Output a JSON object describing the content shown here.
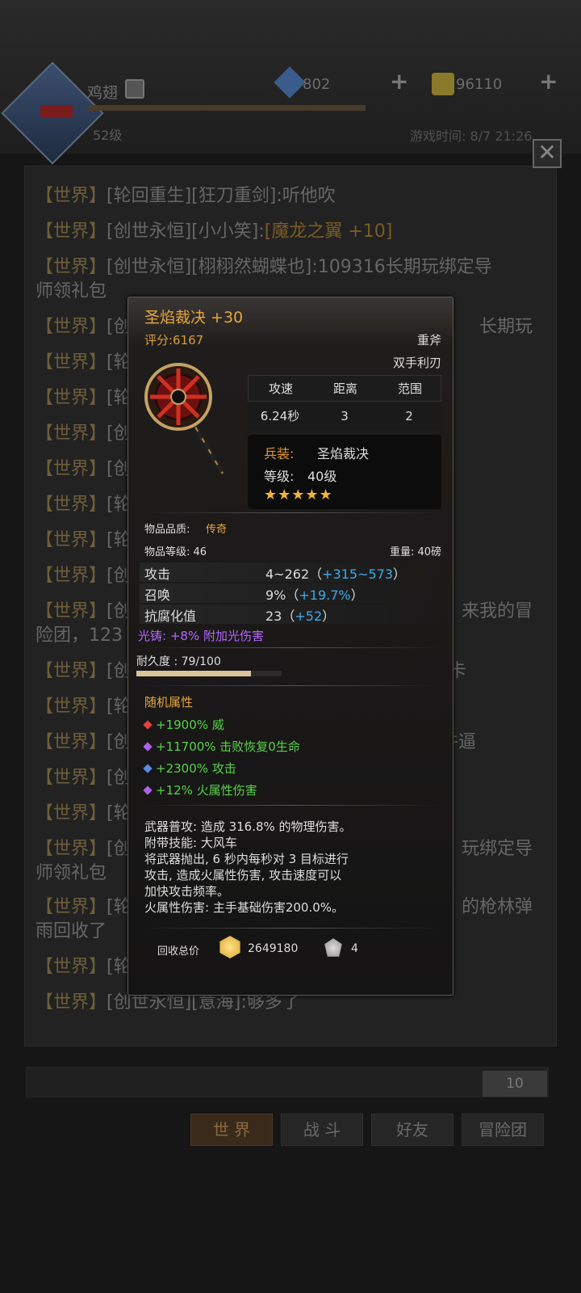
{
  "hud": {
    "player_name": "鸡翅",
    "player_level": "52级",
    "diamonds": "802",
    "gold": "96110",
    "game_time": "游戏时间: 8/7 21:26"
  },
  "chat": {
    "channel_tag": "【世界】",
    "lines": [
      {
        "text": "[轮回重生][狂刀重剑]:听他吹"
      },
      {
        "text": "[创世永恒][小小笑]:",
        "item": "[魔龙之翼 +10]"
      },
      {
        "text": "[创世永恒][栩栩然蝴蝶也]:109316长期玩绑定导",
        "text2": "师领礼包"
      },
      {
        "text": "[创世永恒][",
        "tail": "长期玩"
      },
      {
        "text": "[轮"
      },
      {
        "text": "[轮"
      },
      {
        "text": "[创"
      },
      {
        "text": "[创"
      },
      {
        "text": "[轮"
      },
      {
        "text": "[轮"
      },
      {
        "text": "[创"
      },
      {
        "text": "[创",
        "tail": "来我的冒",
        "text2": "险团，123"
      },
      {
        "text": "[创",
        "tail": "卡"
      },
      {
        "text": "[轮"
      },
      {
        "text": "[创",
        "tail": "牛逼"
      },
      {
        "text": "[创"
      },
      {
        "text": "[轮"
      },
      {
        "text": "[创",
        "tail": "玩绑定导",
        "text2": "师领礼包"
      },
      {
        "text": "[轮",
        "tail": "的枪林弹",
        "text2": "雨回收了"
      },
      {
        "text": "[轮"
      },
      {
        "text": "[创世永恒][意海]:够多了"
      }
    ],
    "message_count": "10"
  },
  "tabs": [
    "世 界",
    "战 斗",
    "好友",
    "冒险团"
  ],
  "item": {
    "name": "圣焰裁决 +30",
    "score": "评分:6167",
    "type": "重斧",
    "subtype": "双手利刃",
    "stats_headers": [
      "攻速",
      "距离",
      "范围"
    ],
    "stats_values": [
      "6.24秒",
      "3",
      "2"
    ],
    "weapon_label": "兵装:",
    "weapon_name": "圣焰裁决",
    "level_label": "等级:",
    "level_value": "40级",
    "stars": "★★★★★",
    "star_count": 5,
    "quality_label": "物品品质:",
    "quality_value": "传奇",
    "item_level": "物品等级: 46",
    "weight": "重量: 40磅",
    "attrs": [
      {
        "label": "攻击",
        "base": "4~262（",
        "bonus": "+315~573",
        "end": "）"
      },
      {
        "label": "召唤",
        "base": "9%（",
        "bonus": "+19.7%",
        "end": "）"
      },
      {
        "label": "抗腐化值",
        "base": "23（",
        "bonus": "+52",
        "end": "）"
      }
    ],
    "light_cast": "光铸: +8% 附加光伤害",
    "durability_label": "耐久度 : 79/100",
    "durability": 0.79,
    "random_title": "随机属性",
    "random_attrs": [
      {
        "text": "+1900% 威",
        "color": "#e84040"
      },
      {
        "text": "+11700% 击败恢复0生命",
        "color": "#b060f0"
      },
      {
        "text": "+2300% 攻击",
        "color": "#5a8ae8"
      },
      {
        "text": "+12% 火属性伤害",
        "color": "#b060f0"
      }
    ],
    "desc": [
      "武器普攻: 造成 316.8% 的物理伤害。",
      "附带技能: 大风车",
      "将武器抛出, 6 秒内每秒对 3 目标进行",
      "攻击, 造成火属性伤害, 攻击速度可以",
      "加快攻击频率。",
      "火属性伤害: 主手基础伤害200.0%。"
    ],
    "recycle_label": "回收总价",
    "recycle_gold": "2649180",
    "recycle_ore": "4"
  }
}
